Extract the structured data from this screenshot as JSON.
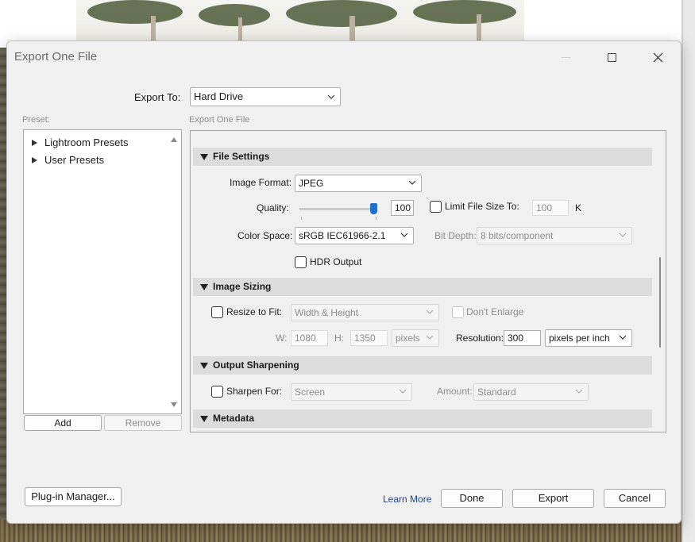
{
  "window": {
    "title": "Export One File"
  },
  "export_to": {
    "label": "Export To:",
    "value": "Hard Drive"
  },
  "preset": {
    "label": "Preset:",
    "items": [
      "Lightroom Presets",
      "User Presets"
    ],
    "add_label": "Add",
    "remove_label": "Remove"
  },
  "settings": {
    "header_label": "Export One File",
    "file_settings": {
      "title": "File Settings",
      "image_format_label": "Image Format:",
      "image_format_value": "JPEG",
      "quality_label": "Quality:",
      "quality_value": "100",
      "quality_level": 1.0,
      "limit_file_size_label": "Limit File Size To:",
      "limit_file_size_value": "100",
      "limit_file_size_unit": "K",
      "color_space_label": "Color Space:",
      "color_space_value": "sRGB IEC61966-2.1",
      "bit_depth_label": "Bit Depth:",
      "bit_depth_value": "8 bits/component",
      "hdr_output_label": "HDR Output"
    },
    "image_sizing": {
      "title": "Image Sizing",
      "resize_label": "Resize to Fit:",
      "resize_value": "Width & Height",
      "dont_enlarge_label": "Don't Enlarge",
      "w_label": "W:",
      "w_value": "1080",
      "h_label": "H:",
      "h_value": "1350",
      "units_value": "pixels",
      "resolution_label": "Resolution:",
      "resolution_value": "300",
      "resolution_unit": "pixels per inch"
    },
    "output_sharpening": {
      "title": "Output Sharpening",
      "sharpen_label": "Sharpen For:",
      "sharpen_value": "Screen",
      "amount_label": "Amount:",
      "amount_value": "Standard"
    },
    "metadata": {
      "title": "Metadata"
    }
  },
  "footer": {
    "plugin_manager_label": "Plug-in Manager...",
    "learn_more_label": "Learn More",
    "done_label": "Done",
    "export_label": "Export",
    "cancel_label": "Cancel"
  },
  "colors": {
    "accent": "#1f6fd1",
    "section_header": "#dcdcdc",
    "dialog_bg": "#f0f0f0",
    "link": "#1b3f9e"
  }
}
